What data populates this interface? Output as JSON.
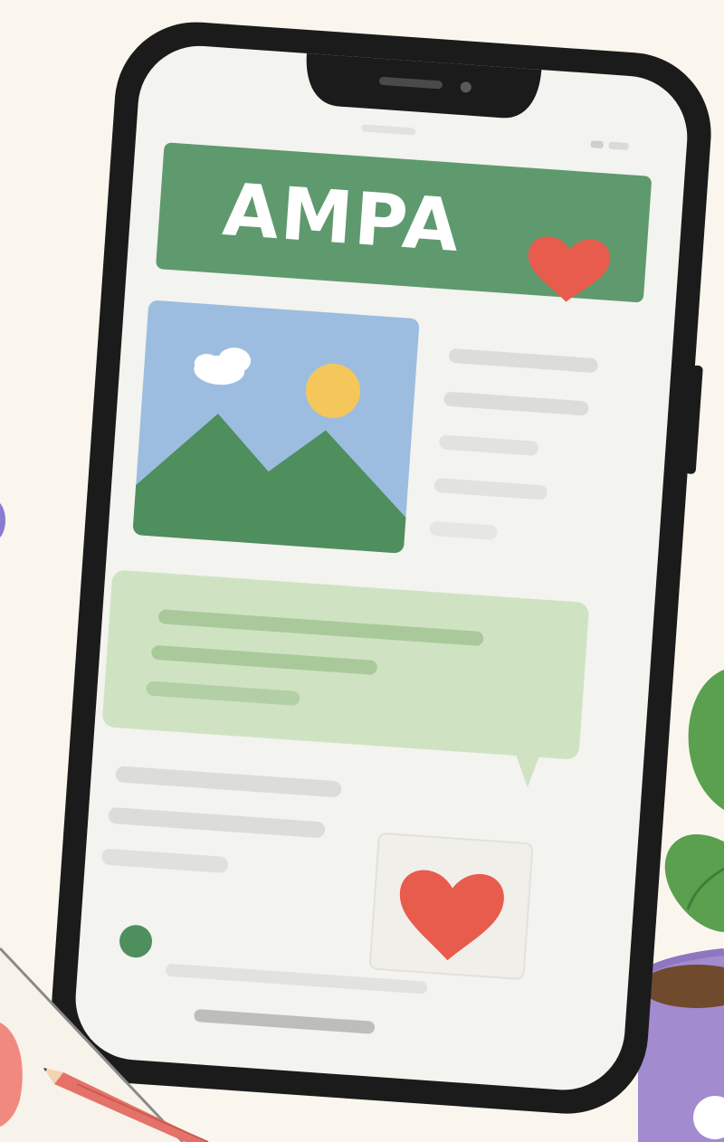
{
  "app": {
    "title": "AMPA"
  },
  "colors": {
    "background": "#faf6ee",
    "phone_frame": "#1b1b1b",
    "screen": "#f3f3ef",
    "header_green": "#5e9a6e",
    "heart_red": "#e85c4e",
    "sky_blue": "#9dbde0",
    "mountain_green": "#4f8e5d",
    "sun_yellow": "#f5c75a",
    "bubble_green": "#cfe3c2",
    "placeholder_gray": "#dcdcd8",
    "mug_purple": "#a28bcf",
    "leaf_green": "#5aa04f"
  },
  "icons": {
    "header_heart": "heart-icon",
    "card_heart": "heart-icon",
    "cloud": "cloud-icon",
    "sun": "sun-icon"
  }
}
